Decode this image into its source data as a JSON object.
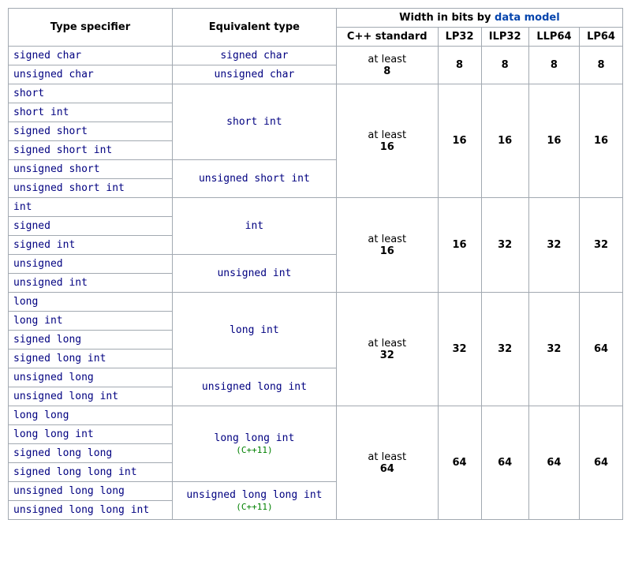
{
  "headers": {
    "type_specifier": "Type specifier",
    "equivalent_type": "Equivalent type",
    "width_group_prefix": "Width in bits by ",
    "width_group_link": "data model",
    "cols": [
      "C++ standard",
      "LP32",
      "ILP32",
      "LLP64",
      "LP64"
    ]
  },
  "at_least_label": "at least",
  "cpp11_mark": "(C++11)",
  "groups": [
    {
      "std_value": "8",
      "widths": [
        "8",
        "8",
        "8",
        "8"
      ],
      "equivs": [
        {
          "label": "signed char",
          "specs": [
            "signed char"
          ]
        },
        {
          "label": "unsigned char",
          "specs": [
            "unsigned char"
          ]
        }
      ]
    },
    {
      "std_value": "16",
      "widths": [
        "16",
        "16",
        "16",
        "16"
      ],
      "equivs": [
        {
          "label": "short int",
          "specs": [
            "short",
            "short int",
            "signed short",
            "signed short int"
          ]
        },
        {
          "label": "unsigned short int",
          "specs": [
            "unsigned short",
            "unsigned short int"
          ]
        }
      ]
    },
    {
      "std_value": "16",
      "widths": [
        "16",
        "32",
        "32",
        "32"
      ],
      "equivs": [
        {
          "label": "int",
          "specs": [
            "int",
            "signed",
            "signed int"
          ]
        },
        {
          "label": "unsigned int",
          "specs": [
            "unsigned",
            "unsigned int"
          ]
        }
      ]
    },
    {
      "std_value": "32",
      "widths": [
        "32",
        "32",
        "32",
        "64"
      ],
      "equivs": [
        {
          "label": "long int",
          "specs": [
            "long",
            "long int",
            "signed long",
            "signed long int"
          ]
        },
        {
          "label": "unsigned long int",
          "specs": [
            "unsigned long",
            "unsigned long int"
          ]
        }
      ]
    },
    {
      "std_value": "64",
      "widths": [
        "64",
        "64",
        "64",
        "64"
      ],
      "equivs": [
        {
          "label": "long long int",
          "mark": true,
          "specs": [
            "long long",
            "long long int",
            "signed long long",
            "signed long long int"
          ]
        },
        {
          "label": "unsigned long long int",
          "mark": true,
          "specs": [
            "unsigned long long",
            "unsigned long long int"
          ]
        }
      ]
    }
  ]
}
